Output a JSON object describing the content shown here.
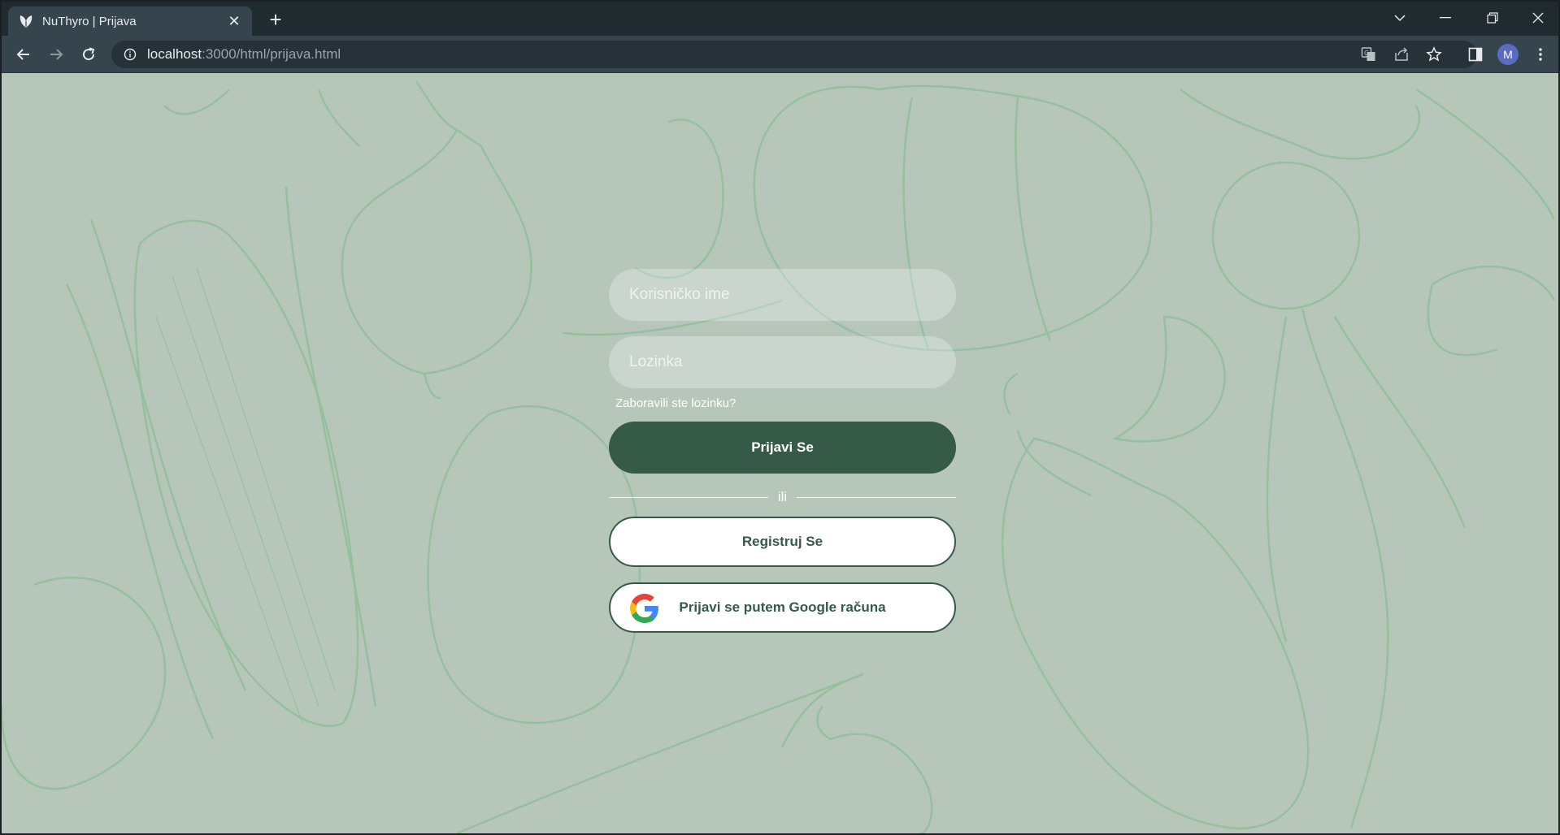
{
  "browser": {
    "tab_title": "NuThyro | Prijava",
    "url_host": "localhost",
    "url_rest": ":3000/html/prijava.html",
    "profile_initial": "M"
  },
  "login": {
    "username_placeholder": "Korisničko ime",
    "password_placeholder": "Lozinka",
    "forgot_label": "Zaboravili ste lozinku?",
    "login_button": "Prijavi Se",
    "divider_text": "ili",
    "register_button": "Registruj Se",
    "google_button": "Prijavi se putem Google računa"
  },
  "colors": {
    "page_background": "#b6c7ba",
    "illustration": "#8fbf98",
    "primary": "#365a48",
    "browser_frame": "#202b30",
    "toolbar": "#36454d"
  },
  "icons": [
    "site-favicon",
    "close-icon",
    "plus-icon",
    "chevron-down-icon",
    "minimize-icon",
    "restore-icon",
    "close-window-icon",
    "back-arrow-icon",
    "forward-arrow-icon",
    "reload-icon",
    "info-icon",
    "translate-icon",
    "share-icon",
    "star-icon",
    "side-panel-icon",
    "kebab-menu-icon",
    "google-icon"
  ]
}
